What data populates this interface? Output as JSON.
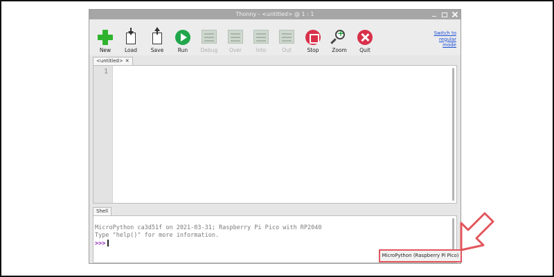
{
  "window": {
    "title": "Thonny  -  <untitled>  @  1 : 1"
  },
  "toolbar": {
    "buttons": [
      {
        "label": "New",
        "icon": "plus-icon",
        "enabled": true
      },
      {
        "label": "Load",
        "icon": "load-icon",
        "enabled": true
      },
      {
        "label": "Save",
        "icon": "save-icon",
        "enabled": true
      },
      {
        "label": "Run",
        "icon": "play-icon",
        "enabled": true
      },
      {
        "label": "Debug",
        "icon": "debug-icon",
        "enabled": false
      },
      {
        "label": "Over",
        "icon": "step-over-icon",
        "enabled": false
      },
      {
        "label": "Into",
        "icon": "step-into-icon",
        "enabled": false
      },
      {
        "label": "Out",
        "icon": "step-out-icon",
        "enabled": false
      },
      {
        "label": "Stop",
        "icon": "stop-icon",
        "enabled": true
      },
      {
        "label": "Zoom",
        "icon": "zoom-icon",
        "enabled": true
      },
      {
        "label": "Quit",
        "icon": "quit-icon",
        "enabled": true
      }
    ],
    "switch_mode": "Switch to regular mode"
  },
  "editor": {
    "tab_label": "<untitled>",
    "tab_close": "✕",
    "line_numbers": [
      "1"
    ]
  },
  "shell": {
    "tab_label": "Shell",
    "lines": [
      "MicroPython ca3d51f on 2021-03-31; Raspberry Pi Pico with RP2040",
      "Type \"help()\" for more information."
    ],
    "prompt": ">>>"
  },
  "statusbar": {
    "interpreter": "MicroPython (Raspberry Pi Pico)"
  },
  "colors": {
    "highlight": "#e2555c",
    "run_green": "#21a64b",
    "stop_red": "#d8304a",
    "prompt_purple": "#8a1fb0",
    "link_blue": "#1a4fd6"
  }
}
